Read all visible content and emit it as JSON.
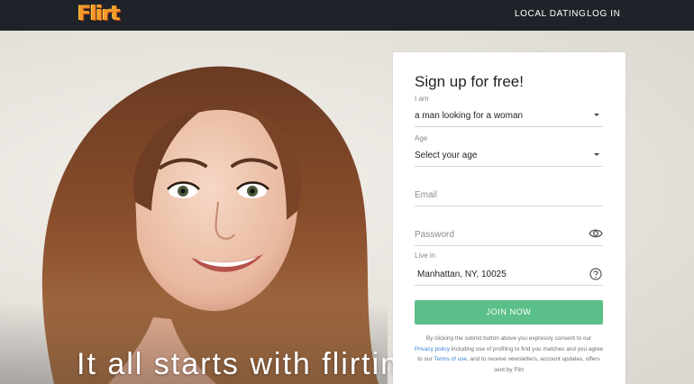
{
  "header": {
    "logo_text": "Flirt",
    "nav": {
      "local_dating": "LOCAL DATING",
      "log_in": "LOG IN"
    }
  },
  "hero": {
    "tagline": "It all starts with flirting!"
  },
  "signup": {
    "title": "Sign up for free!",
    "i_am": {
      "label": "I am",
      "value": "a man looking for a woman"
    },
    "age": {
      "label": "Age",
      "value": "Select your age"
    },
    "email": {
      "placeholder": "Email"
    },
    "password": {
      "placeholder": "Password"
    },
    "live_in": {
      "label": "Live in",
      "value": "Manhattan, NY, 10025"
    },
    "join_button": "JOIN NOW",
    "legal": {
      "part1": "By clicking the submit button above you expressly consent to our",
      "privacy_link": "Privacy policy",
      "part2": "including use of profiling to find you matches and you agree to our",
      "terms_link": "Terms of use",
      "part3": ", and to receive newsletters, account updates, offers sent by Flirt"
    }
  },
  "colors": {
    "topbar": "#1f2329",
    "accent_green": "#5bbf89",
    "link_blue": "#3d86d6",
    "logo_orange": "#f39a2b"
  }
}
